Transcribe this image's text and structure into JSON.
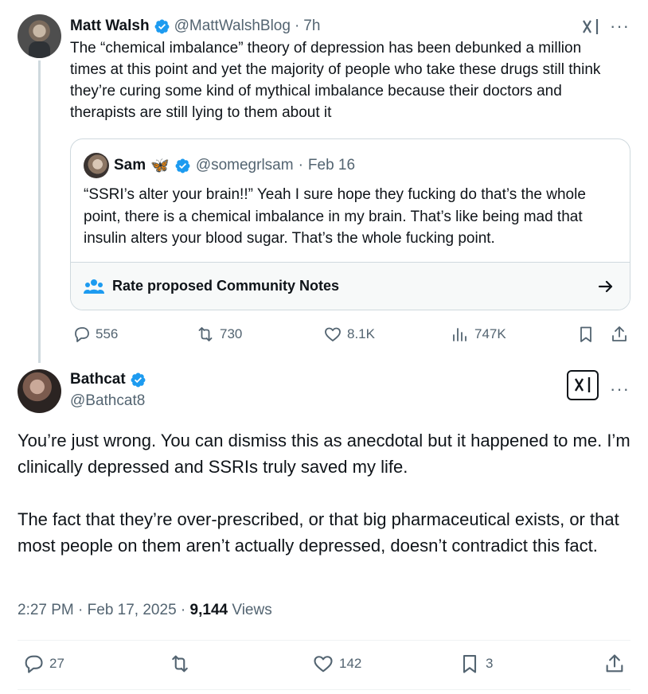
{
  "parent": {
    "author_name": "Matt Walsh",
    "handle": "@MattWalshBlog",
    "separator": "·",
    "time": "7h",
    "text": "The “chemical imbalance” theory of depression has been debunked a million times at this point and yet the majority of people who take these drugs still think they’re curing some kind of mythical imbalance because their doctors and therapists are still lying to them about it",
    "quote": {
      "author_name": "Sam",
      "emoji": "🦋",
      "handle": "@somegrlsam",
      "separator": "·",
      "date": "Feb 16",
      "text": "“SSRI’s alter your brain!!” Yeah I sure hope they fucking do that’s the whole point, there is a chemical imbalance in my brain. That’s like being mad that insulin alters your blood sugar. That’s the whole fucking point."
    },
    "community_notes_label": "Rate proposed Community Notes",
    "stats": {
      "replies": "556",
      "reposts": "730",
      "likes": "8.1K",
      "views": "747K"
    }
  },
  "main": {
    "author_name": "Bathcat",
    "handle": "@Bathcat8",
    "paragraph1": "You’re just wrong. You can dismiss this as anecdotal but it happened to me. I’m clinically depressed and SSRIs truly saved my life.",
    "paragraph2": "The fact that they’re over-prescribed, or that big pharmaceutical exists, or that most people on them aren’t actually depressed, doesn’t contradict this fact.",
    "time": "2:27 PM",
    "date": "Feb 17, 2025",
    "views_count": "9,144",
    "views_label": "Views",
    "stats": {
      "replies": "27",
      "likes": "142",
      "bookmarks": "3"
    }
  },
  "colors": {
    "verified_blue": "#1d9bf0",
    "muted_text": "#536471",
    "border": "#cfd9de",
    "community_notes_accent": "#1d9bf0"
  }
}
